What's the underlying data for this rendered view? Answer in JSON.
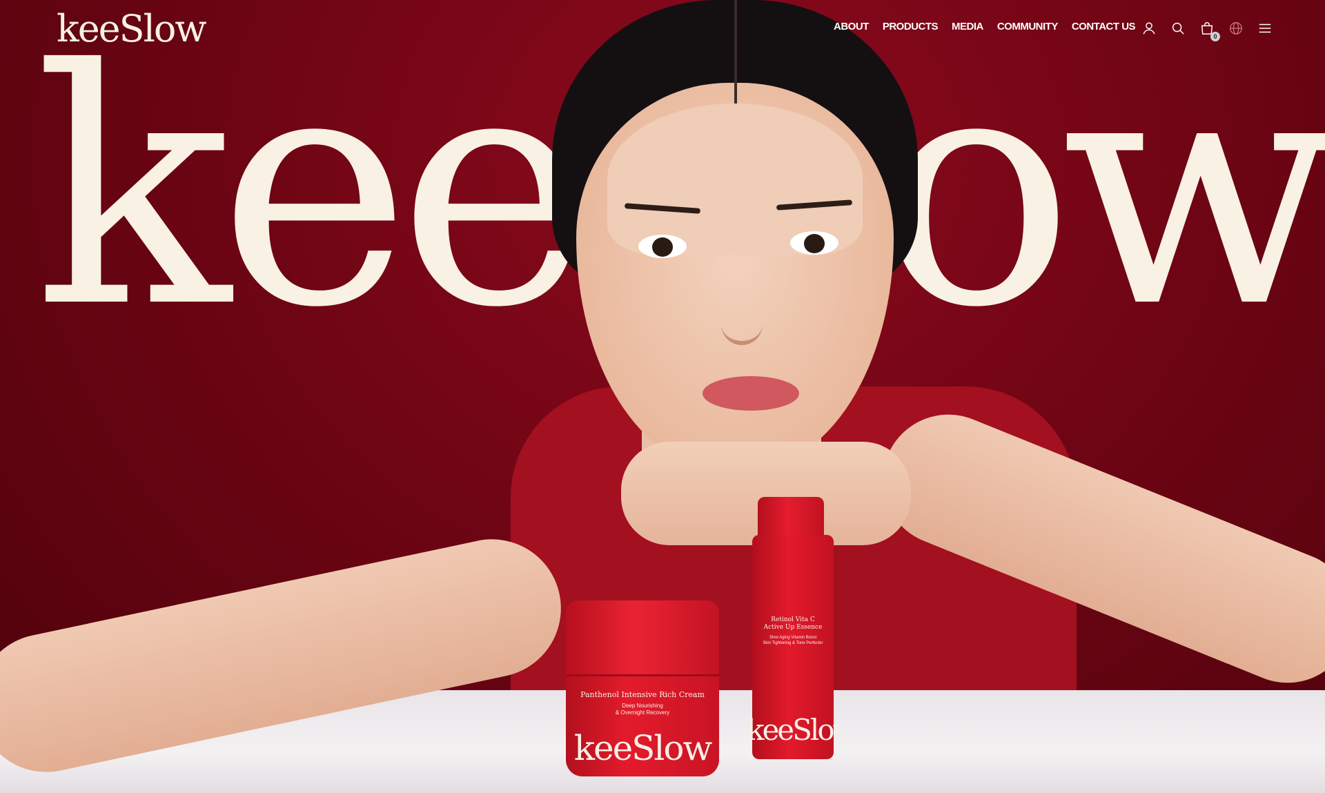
{
  "brand": {
    "logo_text": "keeSlow",
    "hero_wordmark": "keeSlow"
  },
  "nav": {
    "items": [
      {
        "label": "ABOUT"
      },
      {
        "label": "PRODUCTS"
      },
      {
        "label": "MEDIA"
      },
      {
        "label": "COMMUNITY"
      },
      {
        "label": "CONTACT US"
      }
    ]
  },
  "header_icons": {
    "account": "user-icon",
    "search": "search-icon",
    "cart": "shopping-bag-icon",
    "cart_count": "0",
    "language": "globe-icon",
    "menu": "hamburger-menu-icon"
  },
  "products": {
    "jar": {
      "title": "Panthenol Intensive Rich Cream",
      "subtitle": "Deep Nourishing\n& Overnight Recovery",
      "logo": "keeSlow"
    },
    "bottle": {
      "title": "Retinol Vita C\nActive Up Essence",
      "subtitle": "Slow Aging Vitamin Boost\nSkin Tightening & Tone Perfecter",
      "logo": "keeSlow"
    }
  },
  "colors": {
    "background": "#6e0612",
    "wordmark": "#f8f1e4",
    "product_red": "#e31b2c",
    "nav_text": "#ffffff"
  }
}
